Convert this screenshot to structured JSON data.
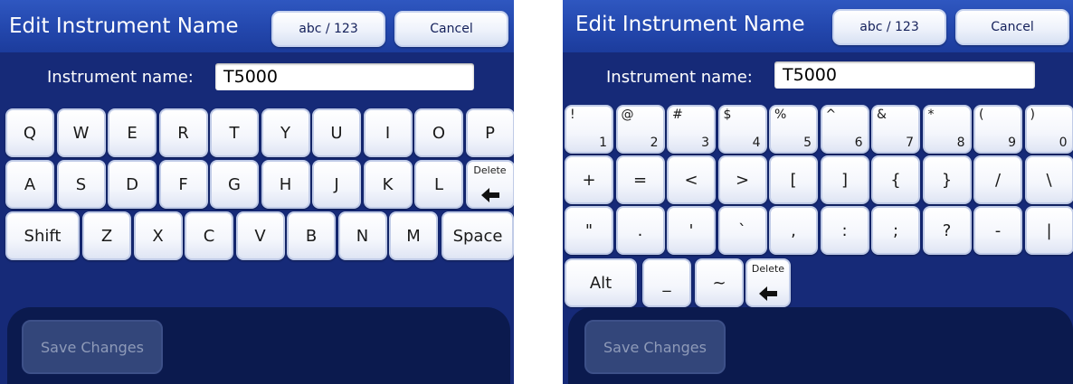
{
  "left": {
    "title": "Edit Instrument Name",
    "mode_button": "abc / 123",
    "cancel_button": "Cancel",
    "name_label": "Instrument name:",
    "name_value": "T5000",
    "rows": [
      [
        "Q",
        "W",
        "E",
        "R",
        "T",
        "Y",
        "U",
        "I",
        "O",
        "P"
      ],
      [
        "A",
        "S",
        "D",
        "F",
        "G",
        "H",
        "J",
        "K",
        "L"
      ],
      [
        "Z",
        "X",
        "C",
        "V",
        "B",
        "N",
        "M"
      ]
    ],
    "delete_label": "Delete",
    "shift_label": "Shift",
    "space_label": "Space",
    "save_button": "Save Changes"
  },
  "right": {
    "title": "Edit Instrument Name",
    "mode_button": "abc / 123",
    "cancel_button": "Cancel",
    "name_label": "Instrument name:",
    "name_value": "T5000",
    "number_row": [
      {
        "top": "!",
        "bottom": "1"
      },
      {
        "top": "@",
        "bottom": "2"
      },
      {
        "top": "#",
        "bottom": "3"
      },
      {
        "top": "$",
        "bottom": "4"
      },
      {
        "top": "%",
        "bottom": "5"
      },
      {
        "top": "^",
        "bottom": "6"
      },
      {
        "top": "&",
        "bottom": "7"
      },
      {
        "top": "*",
        "bottom": "8"
      },
      {
        "top": "(",
        "bottom": "9"
      },
      {
        "top": ")",
        "bottom": "0"
      }
    ],
    "symbol_row1": [
      "+",
      "=",
      "<",
      ">",
      "[",
      "]",
      "{",
      "}",
      "/",
      "\\"
    ],
    "symbol_row2": [
      "\"",
      ".",
      "'",
      "`",
      ",",
      ":",
      ";",
      "?",
      "-",
      "|"
    ],
    "alt_label": "Alt",
    "underscore": "_",
    "tilde": "~",
    "delete_label": "Delete",
    "save_button": "Save Changes"
  },
  "colors": {
    "background": "#162a78",
    "title_bar": "#2347ad",
    "bottom_area": "#0b1a4e",
    "key_face": "#f4f6fc",
    "disabled_button": "#33467a"
  },
  "icons": {
    "delete": "left-arrow-icon"
  }
}
